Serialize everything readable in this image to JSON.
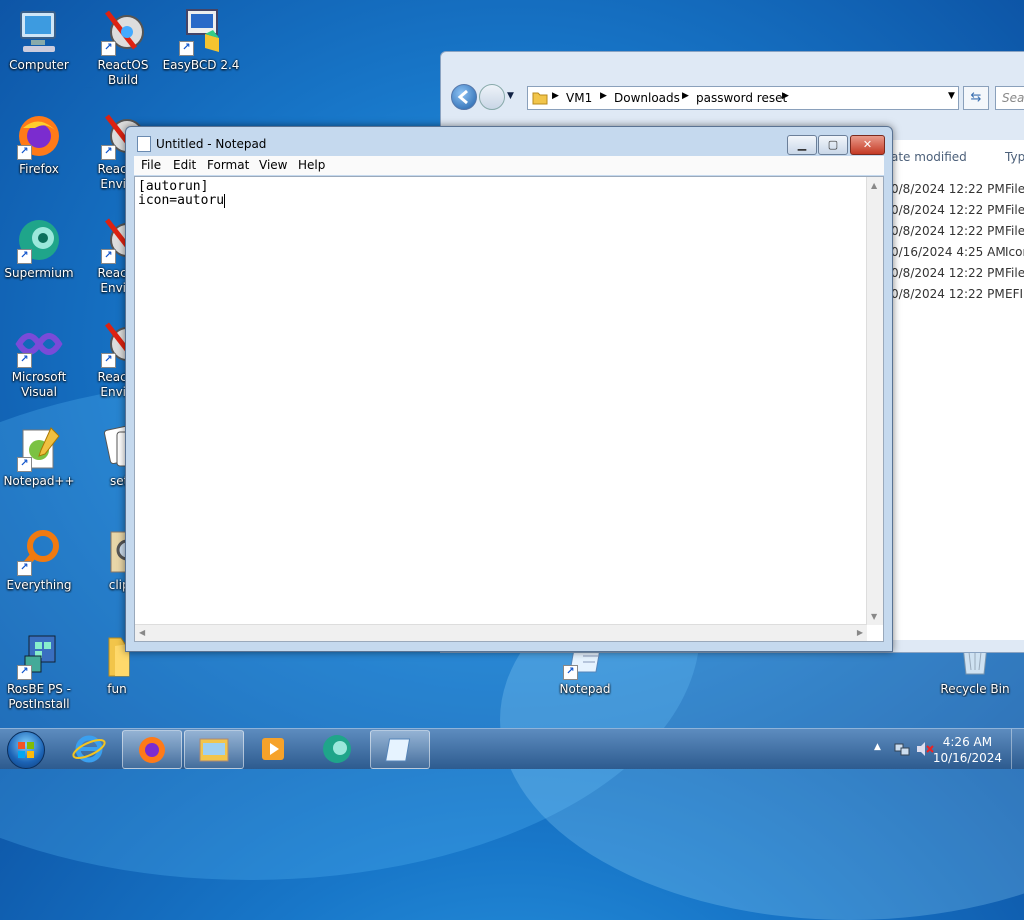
{
  "desktop": {
    "icons": [
      {
        "label": "Computer",
        "icon": "computer-icon"
      },
      {
        "label": "ReactOS Build Environmen...",
        "icon": "reactos-icon"
      },
      {
        "label": "EasyBCD 2.4",
        "icon": "easybcd-icon"
      },
      {
        "label": "Firefox",
        "icon": "firefox-icon"
      },
      {
        "label": "ReactOS",
        "icon": "reactos-icon"
      },
      {
        "label": "Supermium",
        "icon": "supermium-icon"
      },
      {
        "label": "ReactOS",
        "icon": "reactos-icon"
      },
      {
        "label": "Microsoft Visual Stud...",
        "icon": "visual-studio-icon"
      },
      {
        "label": "ReactOS",
        "icon": "reactos-icon"
      },
      {
        "label": "Notepad++",
        "icon": "notepadpp-icon"
      },
      {
        "label": "setu",
        "icon": "cards-icon"
      },
      {
        "label": "Everything",
        "icon": "everything-icon"
      },
      {
        "label": "clipb",
        "icon": "magnifier-icon"
      },
      {
        "label": "RosBE PS - PostInstall",
        "icon": "registry-icon"
      },
      {
        "label": "fun",
        "icon": "folder-icon"
      },
      {
        "label": "Notepad",
        "icon": "notepad-icon"
      },
      {
        "label": "Recycle Bin",
        "icon": "recycle-bin-icon"
      }
    ],
    "reactos_sub": "Environ"
  },
  "explorer": {
    "breadcrumb": [
      "VM1",
      "Downloads",
      "password reset"
    ],
    "search_placeholder": "Search",
    "columns": {
      "date": "ate modified",
      "type": "Typ"
    },
    "rows": [
      {
        "date": "0/8/2024 12:22 PM",
        "type": "File"
      },
      {
        "date": "0/8/2024 12:22 PM",
        "type": "File"
      },
      {
        "date": "0/8/2024 12:22 PM",
        "type": "File"
      },
      {
        "date": "0/16/2024 4:25 AM",
        "type": "Icon"
      },
      {
        "date": "0/8/2024 12:22 PM",
        "type": "File"
      },
      {
        "date": "0/8/2024 12:22 PM",
        "type": "EFI"
      }
    ]
  },
  "notepad": {
    "title": "Untitled - Notepad",
    "menu": [
      "File",
      "Edit",
      "Format",
      "View",
      "Help"
    ],
    "lines": [
      "[autorun]",
      "icon=autoru"
    ]
  },
  "taskbar": {
    "clock_time": "4:26 AM",
    "clock_date": "10/16/2024",
    "apps": [
      "internet-explorer-icon",
      "firefox-icon",
      "file-explorer-icon",
      "media-player-icon",
      "supermium-icon",
      "notepad-icon"
    ]
  },
  "colors": {
    "accent": "#1877c9",
    "close": "#c43a25"
  }
}
